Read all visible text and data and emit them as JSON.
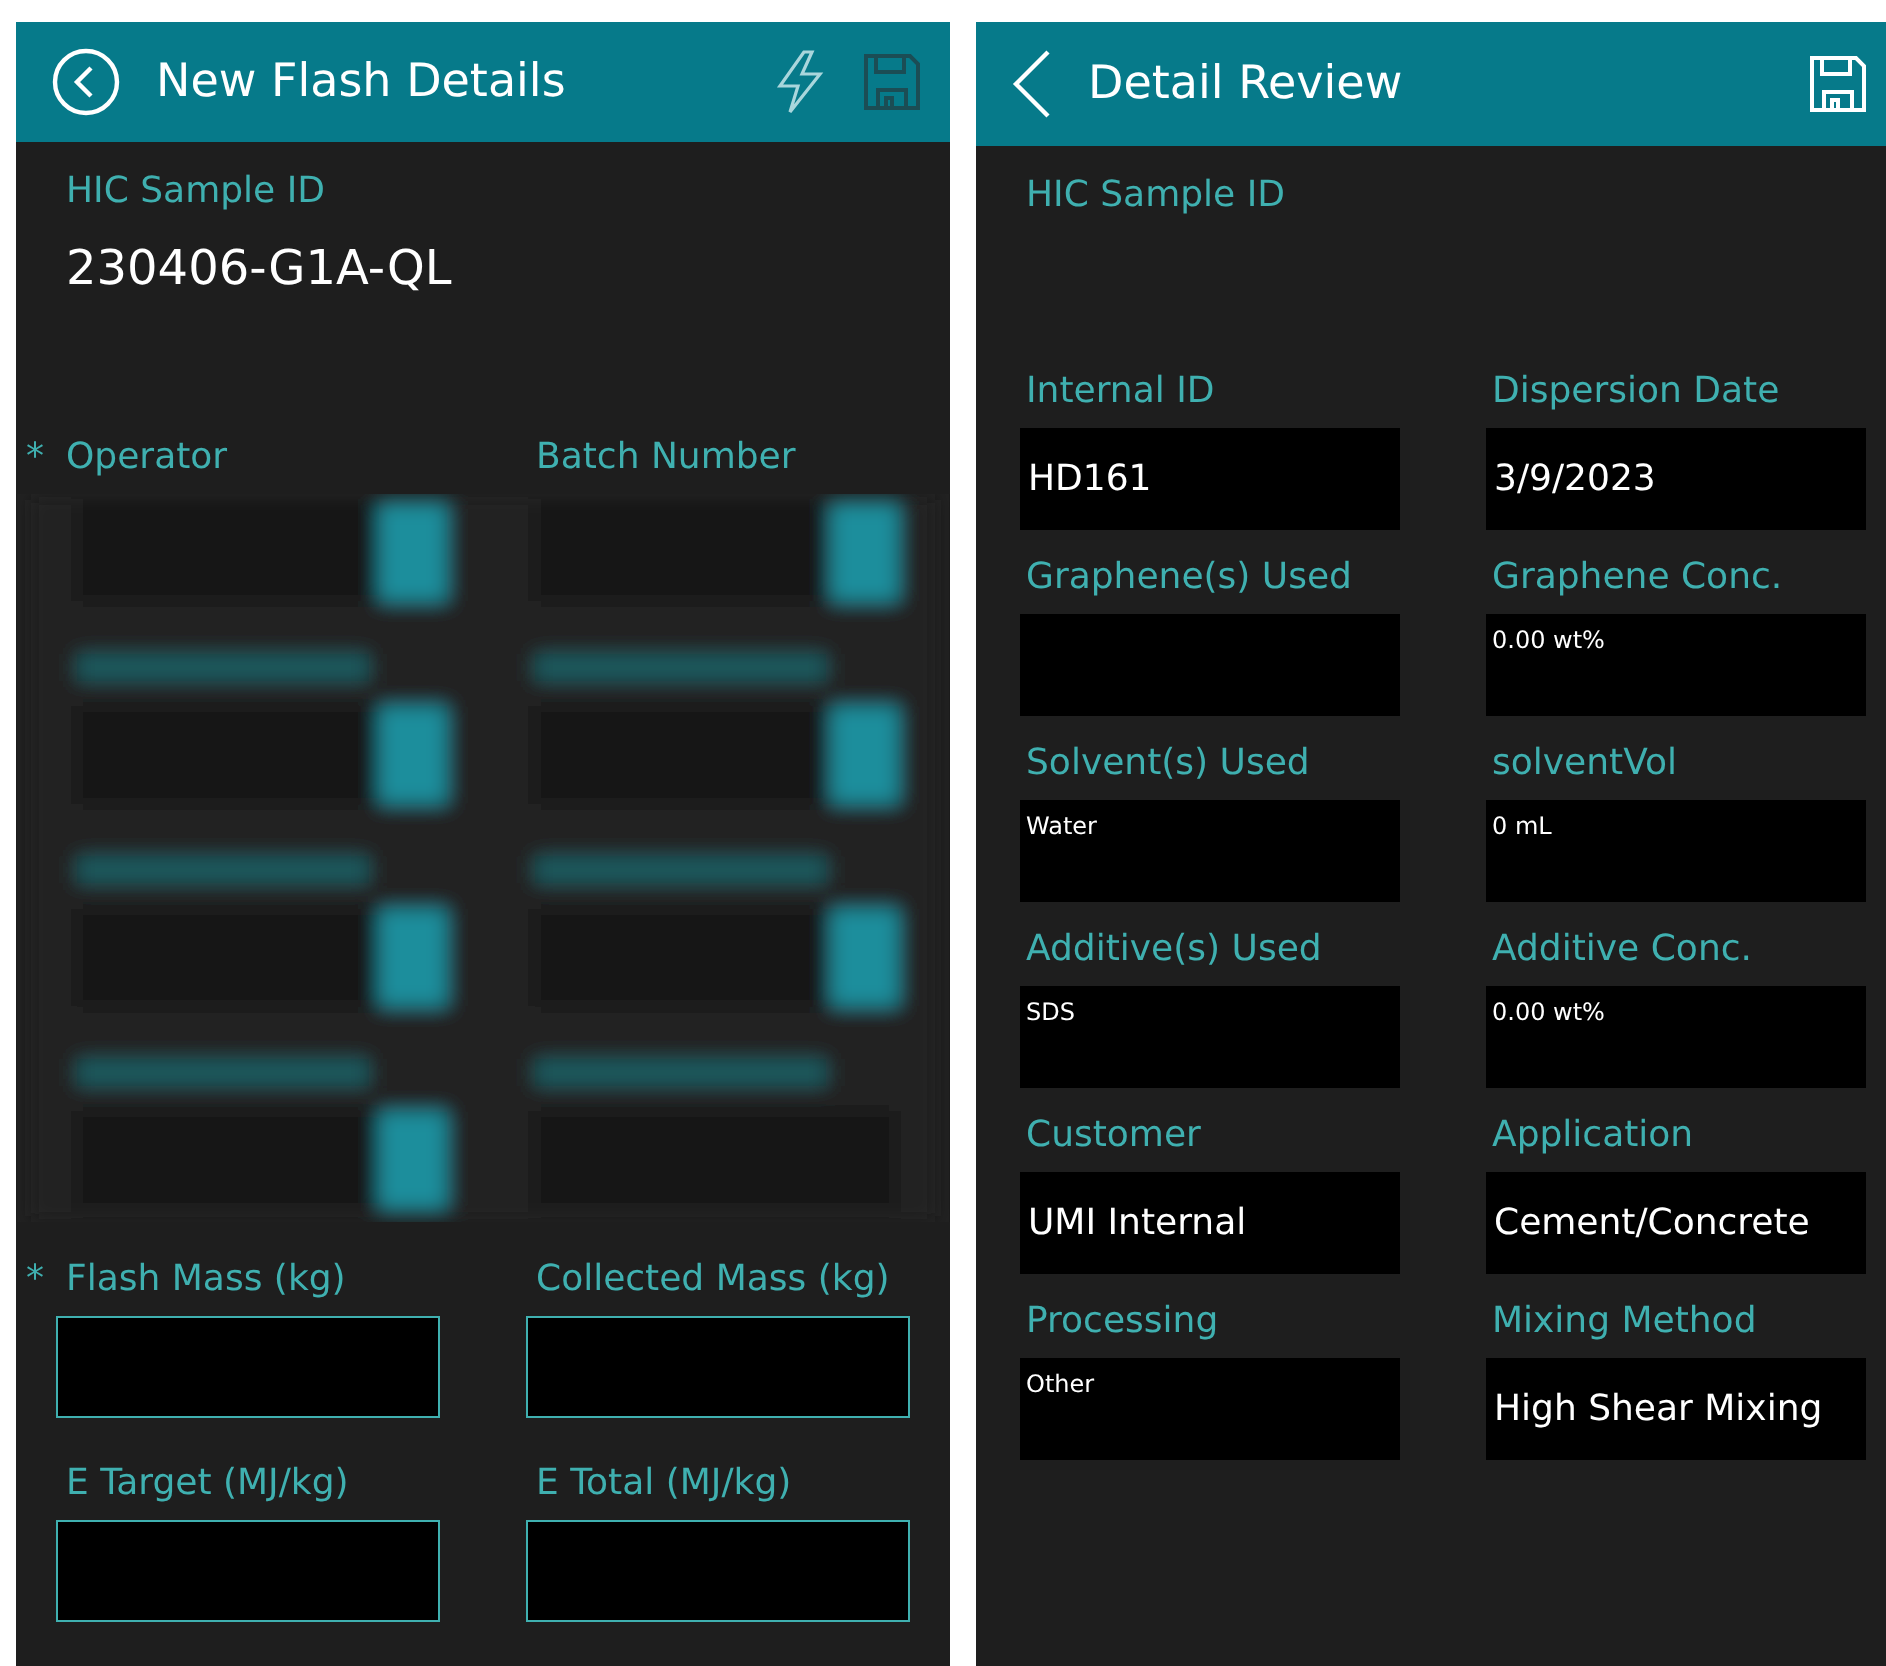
{
  "left_screen": {
    "header": {
      "title": "New Flash Details",
      "save_disabled": true
    },
    "sample_id": {
      "label": "HIC Sample ID",
      "value": "230406-G1A-QL"
    },
    "top_fields": [
      {
        "label": "Operator",
        "required_mark": "*"
      },
      {
        "label": "Batch Number"
      }
    ],
    "fields": [
      {
        "label": "Flash Mass (kg)",
        "required_mark": "*"
      },
      {
        "label": "Collected Mass (kg)"
      },
      {
        "label": "E Target (MJ/kg)"
      },
      {
        "label": "E Total (MJ/kg)"
      }
    ]
  },
  "right_screen": {
    "header": {
      "title": "Detail Review",
      "save_disabled": false
    },
    "sample_id": {
      "label": "HIC Sample ID"
    },
    "fields": [
      {
        "label": "Internal ID",
        "value": "HD161",
        "kind": "large"
      },
      {
        "label": "Dispersion Date",
        "value": "3/9/2023",
        "kind": "large"
      },
      {
        "label": "Graphene(s) Used",
        "kind": "small"
      },
      {
        "label": "Graphene Conc.",
        "value": "0.00 wt%",
        "kind": "small"
      },
      {
        "label": "Solvent(s) Used",
        "value": "Water",
        "kind": "small"
      },
      {
        "label": "solventVol",
        "value": "0 mL",
        "kind": "small"
      },
      {
        "label": "Additive(s) Used",
        "value": "SDS",
        "kind": "small"
      },
      {
        "label": "Additive Conc.",
        "value": "0.00 wt%",
        "kind": "small"
      },
      {
        "label": "Customer",
        "value": "UMI Internal",
        "kind": "large"
      },
      {
        "label": "Application",
        "value": "Cement/Concrete",
        "kind": "large"
      },
      {
        "label": "Processing",
        "value": "Other",
        "kind": "small"
      },
      {
        "label": "Mixing Method",
        "value": "High Shear Mixing",
        "kind": "large"
      }
    ]
  }
}
